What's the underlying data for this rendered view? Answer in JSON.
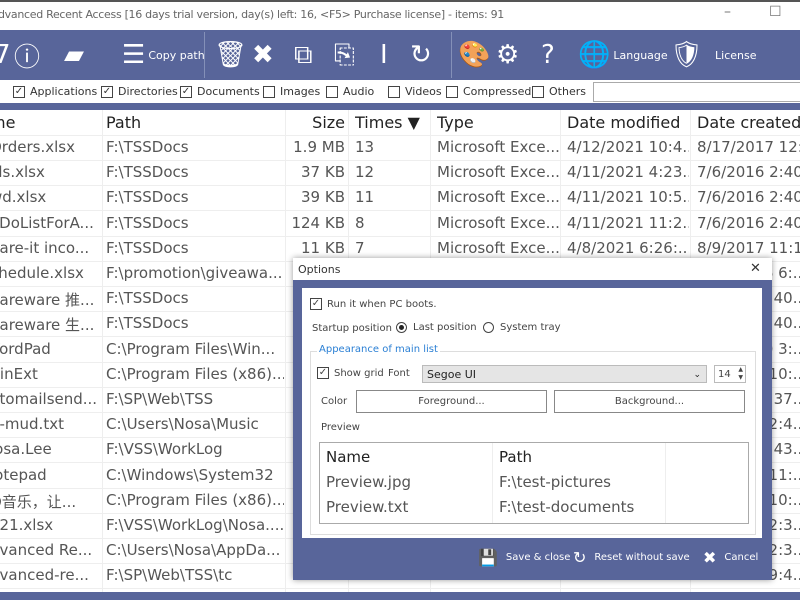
{
  "window": {
    "title": "dvanced Recent Access [16 days trial version,  day(s) left: 16, <F5> Purchase license] - items: 91",
    "minimize": "–",
    "maximize": "☐"
  },
  "toolbar": {
    "copy_path": "Copy path",
    "language": "Language",
    "license": "License",
    "accent": "#58659a"
  },
  "filters": [
    {
      "label": "Applications",
      "checked": true
    },
    {
      "label": "Directories",
      "checked": true
    },
    {
      "label": "Documents",
      "checked": true
    },
    {
      "label": "Images",
      "checked": false
    },
    {
      "label": "Audio",
      "checked": false
    },
    {
      "label": "Videos",
      "checked": false
    },
    {
      "label": "Compressed",
      "checked": false
    },
    {
      "label": "Others",
      "checked": false
    }
  ],
  "search": {
    "value": ""
  },
  "table": {
    "columns": [
      "me",
      "Path",
      "Size",
      "Times ▼",
      "Type",
      "Date modified",
      "Date created"
    ],
    "rows": [
      [
        "Orders.xlsx",
        "F:\\TSSDocs",
        "1.9 MB",
        "13",
        "Microsoft Exce...",
        "4/12/2021 10:4...",
        "8/17/2017 12:..."
      ],
      [
        "ills.xlsx",
        "F:\\TSSDocs",
        "37 KB",
        "12",
        "Microsoft Exce...",
        "4/11/2021 4:23...",
        "7/6/2016 2:40..."
      ],
      [
        "wd.xlsx",
        "F:\\TSSDocs",
        "39 KB",
        "11",
        "Microsoft Exce...",
        "4/11/2021 10:5...",
        "7/6/2016 2:40..."
      ],
      [
        "oDoListForA...",
        "F:\\TSSDocs",
        "124 KB",
        "8",
        "Microsoft Exce...",
        "4/11/2021 11:2...",
        "7/6/2016 2:40..."
      ],
      [
        "hare-it inco...",
        "F:\\TSSDocs",
        "11 KB",
        "7",
        "Microsoft Exce...",
        "4/8/2021 6:26:...",
        "8/9/2017 11:1..."
      ],
      [
        "chedule.xlsx",
        "F:\\promotion\\giveawa...",
        "",
        "",
        "",
        "",
        "6 6:..."
      ],
      [
        "hareware 推...",
        "F:\\TSSDocs",
        "",
        "",
        "",
        "",
        ":40..."
      ],
      [
        "hareware 生...",
        "F:\\TSSDocs",
        "",
        "",
        "",
        "",
        ":40..."
      ],
      [
        "VordPad",
        "C:\\Program Files\\Win...",
        "",
        "",
        "",
        "",
        "0 3:..."
      ],
      [
        "VinExt",
        "C:\\Program Files (x86)...",
        "",
        "",
        "",
        "",
        "10:..."
      ],
      [
        "utomailsend...",
        "F:\\SP\\Web\\TSS",
        "",
        "",
        "",
        "",
        ":37..."
      ],
      [
        "n-mud.txt",
        "C:\\Users\\Nosa\\Music",
        "",
        "",
        "",
        "",
        "2:4..."
      ],
      [
        "losa.Lee",
        "F:\\VSS\\WorkLog",
        "",
        "",
        "",
        "",
        ":43..."
      ],
      [
        "lotepad",
        "C:\\Windows\\System32",
        "",
        "",
        "",
        "",
        "11:..."
      ],
      [
        "Q音乐，让...",
        "C:\\Program Files (x86)...",
        "",
        "",
        "",
        "",
        "10:..."
      ],
      [
        "021.xlsx",
        "F:\\VSS\\WorkLog\\Nosa....",
        "",
        "",
        "",
        "",
        "2:3..."
      ],
      [
        "dvanced Re...",
        "C:\\Users\\Nosa\\AppDa...",
        "",
        "",
        "",
        "",
        "2:3..."
      ],
      [
        "dvanced-re...",
        "F:\\SP\\Web\\TSS\\tc",
        "",
        "",
        "",
        "",
        "9:4..."
      ]
    ]
  },
  "dialog": {
    "title": "Options",
    "close": "✕",
    "run_at_boot": {
      "label": "Run it when PC boots.",
      "checked": true
    },
    "startup_label": "Startup position",
    "startup_options": [
      {
        "label": "Last position",
        "selected": true
      },
      {
        "label": "System tray",
        "selected": false
      }
    ],
    "appearance_legend": "Appearance of main list",
    "show_grid": {
      "label": "Show grid",
      "checked": true
    },
    "font_label": "Font",
    "font_value": "Segoe UI",
    "font_size": "14",
    "color_label": "Color",
    "foreground": "Foreground...",
    "background": "Background...",
    "preview_label": "Preview",
    "preview": {
      "columns": [
        "Name",
        "Path"
      ],
      "rows": [
        [
          "Preview.jpg",
          "F:\\test-pictures"
        ],
        [
          "Preview.txt",
          "F:\\test-documents"
        ]
      ]
    },
    "save": "Save & close",
    "reset": "Reset without save",
    "cancel": "Cancel"
  }
}
